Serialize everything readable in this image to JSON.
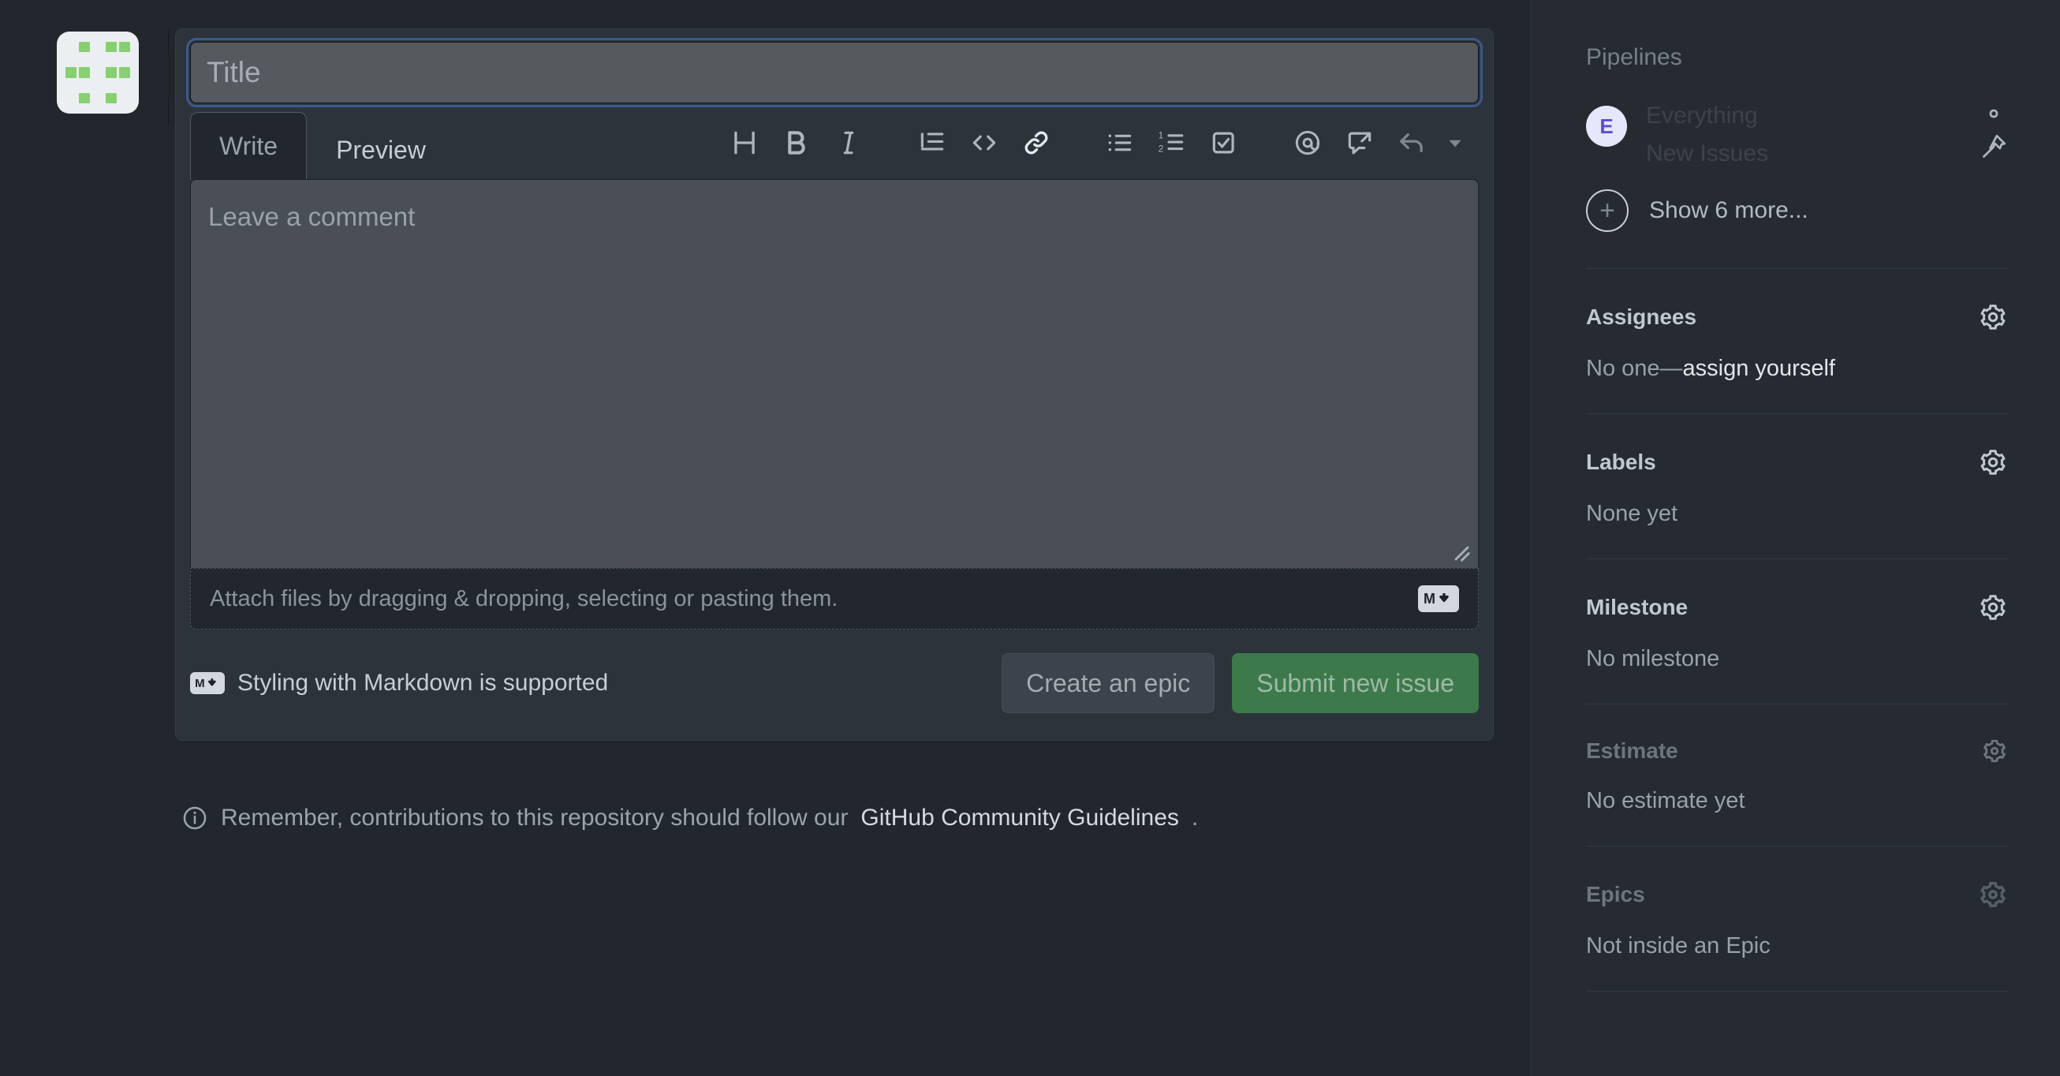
{
  "form": {
    "title_placeholder": "Title",
    "title_value": "",
    "comment_placeholder": "Leave a comment",
    "attach_text": "Attach files by dragging & dropping, selecting or pasting them.",
    "markdown_note": "Styling with Markdown is supported",
    "tabs": [
      {
        "label": "Write",
        "active": true
      },
      {
        "label": "Preview",
        "active": false
      }
    ],
    "toolbar": [
      {
        "name": "heading-icon",
        "label": "H"
      },
      {
        "name": "bold-icon",
        "label": "B"
      },
      {
        "name": "italic-icon",
        "label": "I"
      },
      {
        "name": "quote-icon",
        "label": "Quote"
      },
      {
        "name": "code-icon",
        "label": "<>"
      },
      {
        "name": "link-icon",
        "label": "Link"
      },
      {
        "name": "unordered-list-icon",
        "label": "Bulleted list"
      },
      {
        "name": "ordered-list-icon",
        "label": "Numbered list"
      },
      {
        "name": "task-list-icon",
        "label": "Task list"
      },
      {
        "name": "mention-icon",
        "label": "@"
      },
      {
        "name": "reference-icon",
        "label": "Reference"
      },
      {
        "name": "reply-icon",
        "label": "Saved replies"
      },
      {
        "name": "chevron-down-icon",
        "label": "More"
      }
    ],
    "buttons": {
      "create_epic": "Create an epic",
      "submit": "Submit new issue"
    }
  },
  "guidelines": {
    "prefix": "Remember, contributions to this repository should follow our ",
    "link": "GitHub Community Guidelines",
    "suffix": "."
  },
  "sidebar": {
    "pipelines": {
      "title": "Pipelines",
      "avatar_initial": "E",
      "line1": "Everything",
      "line2": "New Issues",
      "show_more": "Show 6 more...",
      "plus": "+"
    },
    "sections": [
      {
        "name": "assignees",
        "header": "Assignees",
        "dim": false,
        "value_muted": "No one—",
        "value_link": "assign yourself"
      },
      {
        "name": "labels",
        "header": "Labels",
        "dim": false,
        "value_muted": "None yet",
        "value_link": ""
      },
      {
        "name": "milestone",
        "header": "Milestone",
        "dim": false,
        "value_muted": "No milestone",
        "value_link": ""
      },
      {
        "name": "estimate",
        "header": "Estimate",
        "dim": true,
        "value_muted": "No estimate yet",
        "value_link": ""
      },
      {
        "name": "epics",
        "header": "Epics",
        "dim": true,
        "value_muted": "Not inside an Epic",
        "value_link": ""
      }
    ]
  },
  "colors": {
    "page_bg": "#22272e",
    "panel_bg": "#2d333b",
    "accent_green": "#3d7a4b",
    "focus_blue": "#3b5a8c",
    "avatar_green": "#86d072",
    "pipeline_avatar_bg": "#e6e7fb",
    "pipeline_avatar_fg": "#5b4fcf"
  }
}
